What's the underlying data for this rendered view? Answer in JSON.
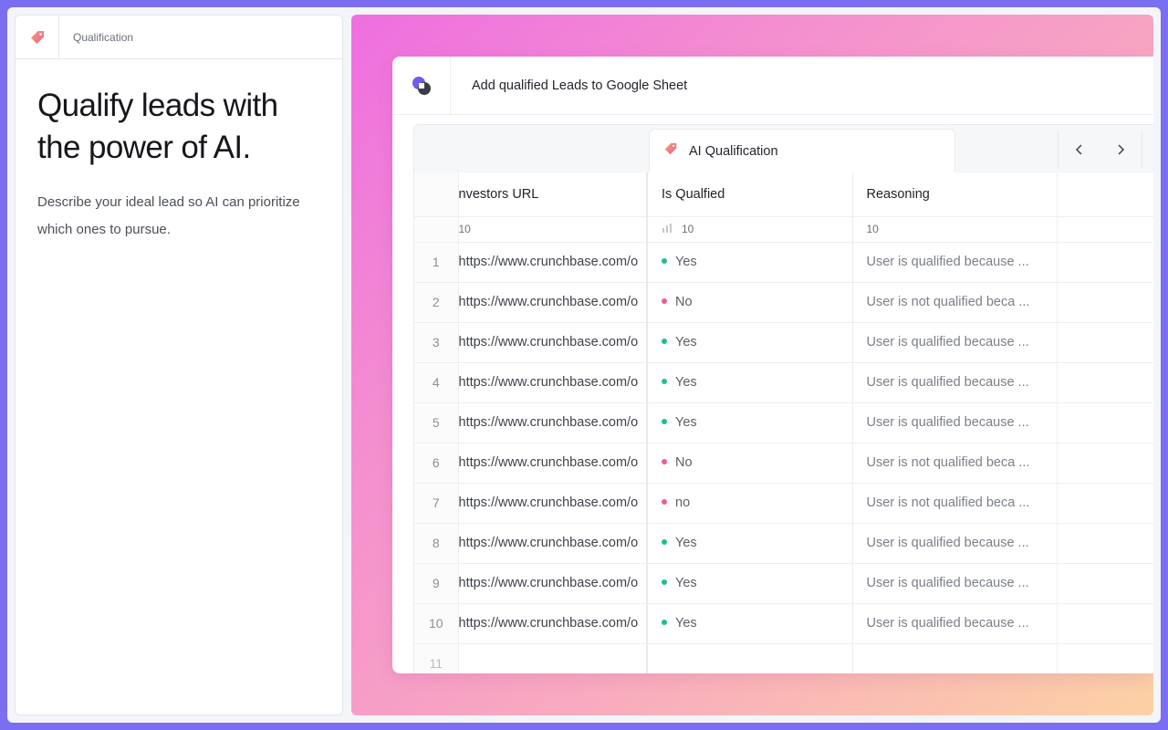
{
  "left": {
    "breadcrumb": "Qualification",
    "headline": "Qualify leads with the power of AI.",
    "description": "Describe your ideal lead so AI can prioritize which ones to pursue.",
    "tag_icon": "tag-icon"
  },
  "app": {
    "title": "Add qualified Leads to Google Sheet",
    "logo_icon": "app-logo-icon"
  },
  "group": {
    "label": "AI Qualification",
    "icon": "tag-icon"
  },
  "nav": {
    "prev_icon": "chevron-left-icon",
    "next_icon": "chevron-right-icon"
  },
  "columns": {
    "url": "nvestors URL",
    "qualified": "Is Qualfied",
    "reasoning": "Reasoning"
  },
  "counts": {
    "url": "10",
    "qualified": "10",
    "reasoning": "10"
  },
  "colors": {
    "yes": "#1fbf8f",
    "no": "#ef5b9b",
    "brand_purple": "#7b6ef0"
  },
  "rows": [
    {
      "index": "1",
      "url": "https://www.crunchbase.com/o",
      "qualified": "Yes",
      "status": "yes",
      "reasoning": "User is qualified because ..."
    },
    {
      "index": "2",
      "url": "https://www.crunchbase.com/o",
      "qualified": "No",
      "status": "no",
      "reasoning": "User is not qualified beca ..."
    },
    {
      "index": "3",
      "url": "https://www.crunchbase.com/o",
      "qualified": "Yes",
      "status": "yes",
      "reasoning": "User is qualified because ..."
    },
    {
      "index": "4",
      "url": "https://www.crunchbase.com/o",
      "qualified": "Yes",
      "status": "yes",
      "reasoning": "User is qualified because ..."
    },
    {
      "index": "5",
      "url": "https://www.crunchbase.com/o",
      "qualified": "Yes",
      "status": "yes",
      "reasoning": "User is qualified because ..."
    },
    {
      "index": "6",
      "url": "https://www.crunchbase.com/o",
      "qualified": "No",
      "status": "no",
      "reasoning": "User is not qualified beca ..."
    },
    {
      "index": "7",
      "url": "https://www.crunchbase.com/o",
      "qualified": "no",
      "status": "no",
      "reasoning": "User is not qualified beca ..."
    },
    {
      "index": "8",
      "url": "https://www.crunchbase.com/o",
      "qualified": "Yes",
      "status": "yes",
      "reasoning": "User is qualified because ..."
    },
    {
      "index": "9",
      "url": "https://www.crunchbase.com/o",
      "qualified": "Yes",
      "status": "yes",
      "reasoning": "User is qualified because ..."
    },
    {
      "index": "10",
      "url": "https://www.crunchbase.com/o",
      "qualified": "Yes",
      "status": "yes",
      "reasoning": "User is qualified because ..."
    }
  ],
  "empty_row_index": "11"
}
